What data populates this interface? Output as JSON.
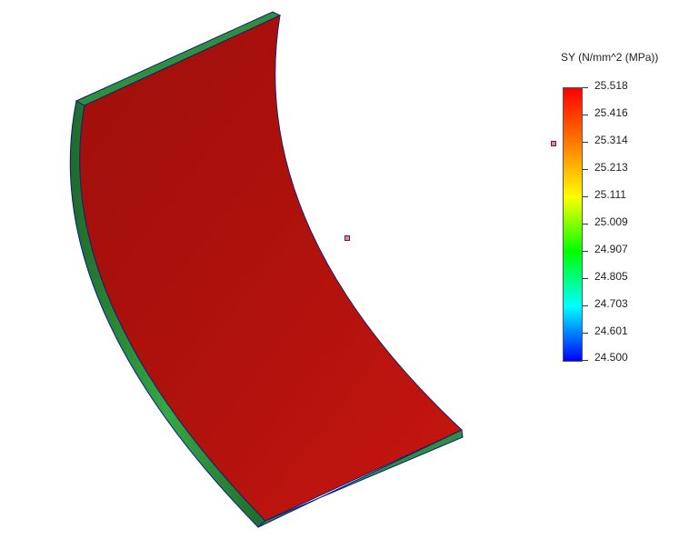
{
  "legend": {
    "title": "SY (N/mm^2 (MPa))",
    "ticks": [
      "25.518",
      "25.416",
      "25.314",
      "25.213",
      "25.111",
      "25.009",
      "24.907",
      "24.805",
      "24.703",
      "24.601",
      "24.500"
    ],
    "max": 25.518,
    "min": 24.5,
    "colors": [
      "#ff0000",
      "#ff7a00",
      "#ffff00",
      "#00ff00",
      "#00ffff",
      "#0000ff"
    ]
  },
  "model": {
    "face_color": "#b0120d",
    "face_color_light": "#c8160f",
    "edge_color": "#2e7d3a",
    "edge_highlight": "#3fbf4a",
    "outline_color": "#0a1a8a"
  },
  "probes": {
    "color": "#e57fb5"
  }
}
